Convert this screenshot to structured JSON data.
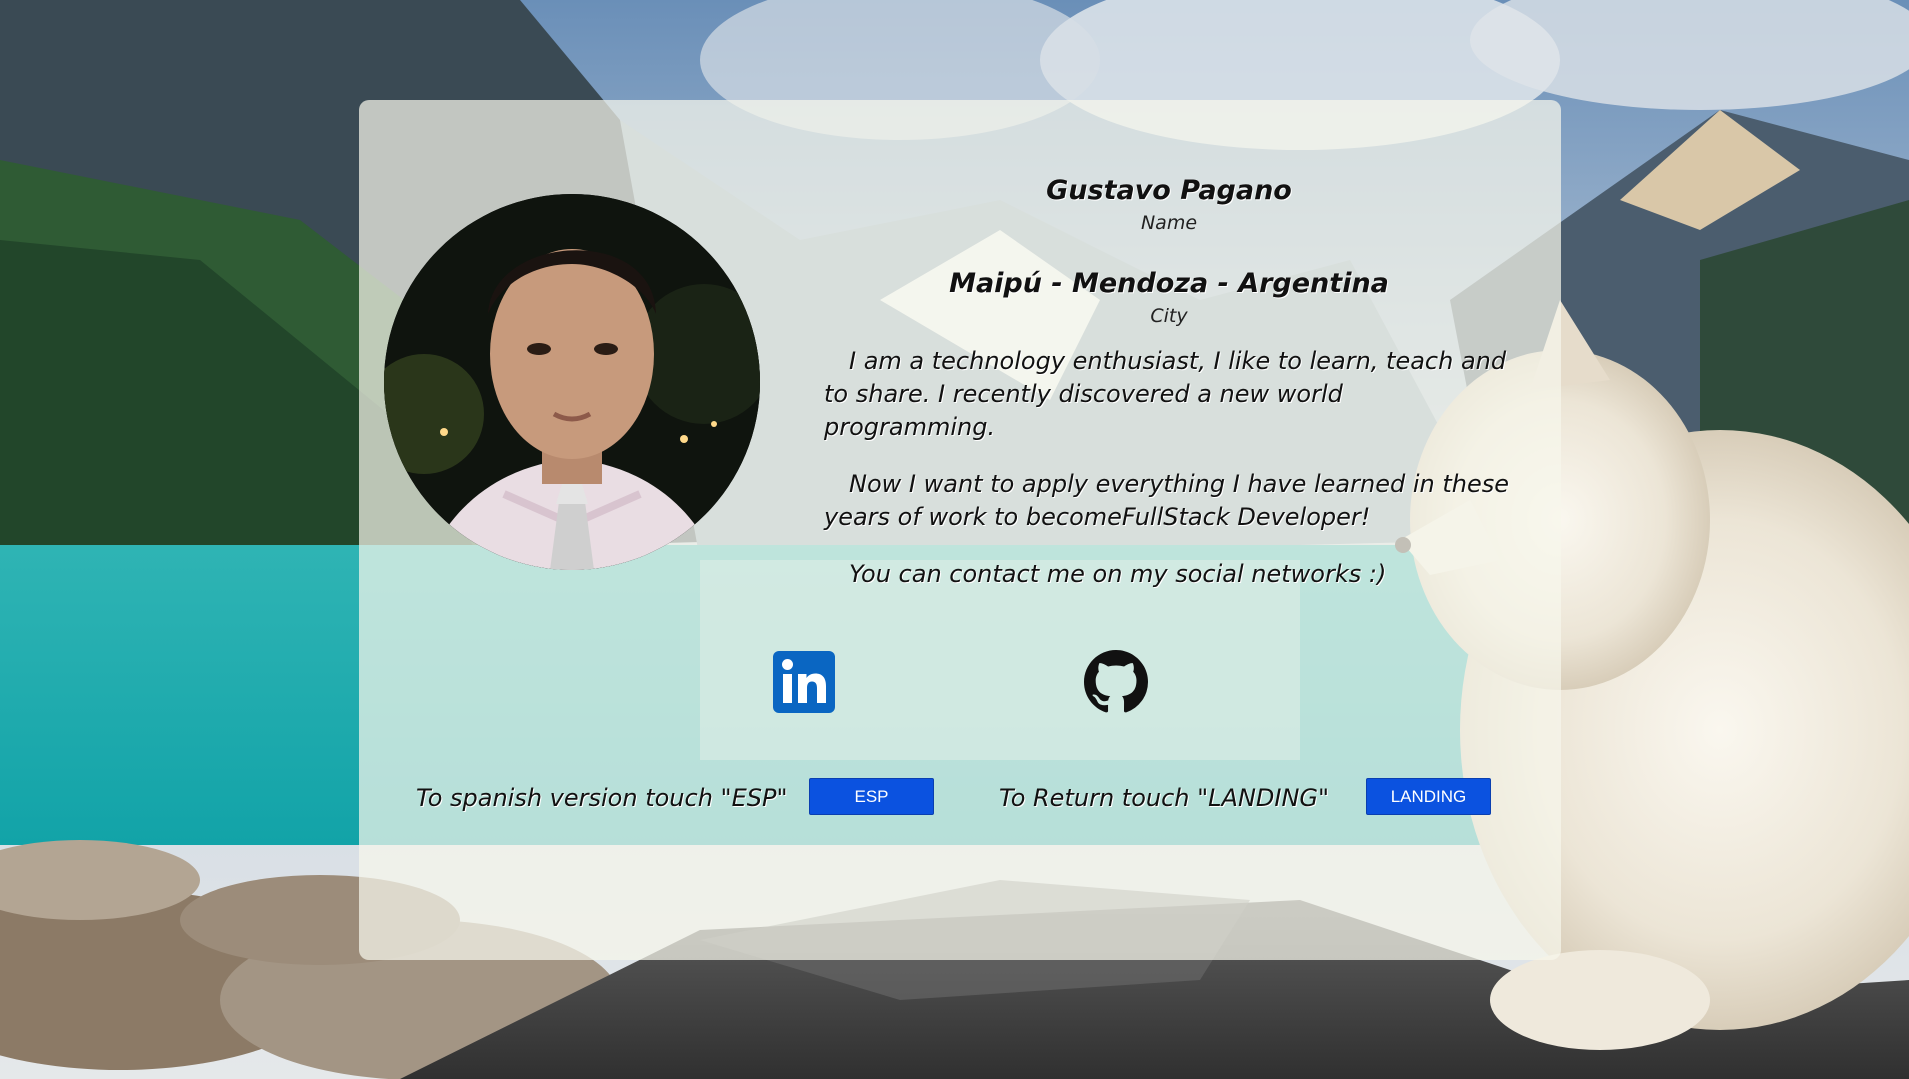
{
  "profile": {
    "name": "Gustavo Pagano",
    "name_caption": "Name",
    "city": "Maipú - Mendoza - Argentina",
    "city_caption": "City",
    "bio": [
      "I am a technology enthusiast, I like to learn, teach and to share. I recently discovered a new world programming.",
      "Now I want to apply everything I have learned in these years of work to becomeFullStack Developer!",
      "You can contact me on my social networks :)"
    ]
  },
  "social": {
    "linkedin_icon": "linkedin-icon",
    "github_icon": "github-icon",
    "linkedin_color": "#0a66c2"
  },
  "footer": {
    "spanish_prompt": "To spanish version touch \"ESP\"",
    "esp_label": "ESP",
    "landing_prompt": "To Return touch \"LANDING\"",
    "landing_label": "LANDING",
    "button_color": "#0b52e0"
  }
}
